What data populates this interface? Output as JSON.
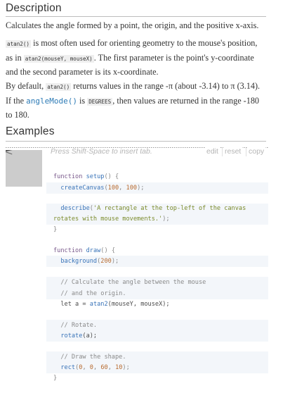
{
  "description": {
    "heading": "Description",
    "p1": "Calculates the angle formed by a point, the origin, and the positive x-axis.",
    "p2": {
      "code1": "atan2()",
      "t1": " is most often used for orienting geometry to the mouse's position,",
      "t2": "as in ",
      "code2": "atan2(mouseY, mouseX)",
      "t3": ". The first parameter is the point's y-coordinate",
      "t4": "and the second parameter is its x-coordinate."
    },
    "p3": {
      "t1": "By default, ",
      "code1": "atan2()",
      "t2": " returns values in the range -π (about -3.14) to π (3.14).",
      "t3": "If the ",
      "link": "angleMode()",
      "t4": " is ",
      "code2": "DEGREES",
      "t5": ", then values are returned in the range -180",
      "t6": "to 180."
    }
  },
  "examples": {
    "heading": "Examples",
    "placeholder": "Press Shift-Space to insert tab.",
    "buttons": {
      "edit": "edit",
      "reset": "reset",
      "copy": "copy"
    }
  },
  "code": {
    "l1_kw": "function",
    "l1_fn": "setup",
    "l1_rest": "() {",
    "l2_fn": "createCanvas",
    "l2_open": "(",
    "l2_n1": "100",
    "l2_sep": ", ",
    "l2_n2": "100",
    "l2_close": ");",
    "l3_fn": "describe",
    "l3_open": "(",
    "l3_str_a": "'A rectangle at the top-left of the canvas",
    "l3_str_b": "rotates with mouse movements.'",
    "l3_close": ");",
    "l4": "}",
    "l5_kw": "function",
    "l5_fn": "draw",
    "l5_rest": "() {",
    "l6_fn": "background",
    "l6_open": "(",
    "l6_n": "200",
    "l6_close": ");",
    "l7": "// Calculate the angle between the mouse",
    "l8": "// and the origin.",
    "l9_a": "let a = ",
    "l9_fn": "atan2",
    "l9_b": "(mouseY, mouseX);",
    "l10": "// Rotate.",
    "l11_fn": "rotate",
    "l11_b": "(a);",
    "l12": "// Draw the shape.",
    "l13_fn": "rect",
    "l13_open": "(",
    "l13_n1": "0",
    "l13_n2": "0",
    "l13_n3": "60",
    "l13_n4": "10",
    "l13_sep": ", ",
    "l13_close": ");",
    "l14": "}"
  }
}
